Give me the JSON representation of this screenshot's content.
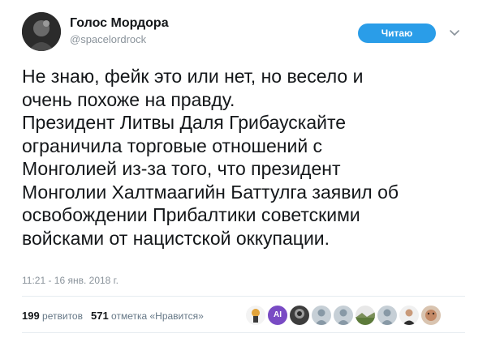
{
  "author": {
    "name": "Голос Мордора",
    "handle": "@spacelordrock"
  },
  "follow_button": "Читаю",
  "tweet_lines": [
    "Не знаю, фейк это или нет, но весело и",
    "очень похоже на правду.",
    "Президент Литвы Даля Грибаускайте",
    "ограничила торговые отношений с",
    "Монголией из-за того, что президент",
    "Монголии Халтмаагийн Баттулга заявил об",
    "освобождении Прибалтики советскими",
    "войсками от нацистской оккупации."
  ],
  "timestamp": "11:21 - 16 янв. 2018 г.",
  "stats": {
    "retweets_count": "199",
    "retweets_label": "ретвитов",
    "likes_count": "571",
    "likes_label": "отметка «Нравится»"
  },
  "liker_avatars": [
    {
      "icon": "character-avatar"
    },
    {
      "icon": "ai-avatar",
      "text": "AI"
    },
    {
      "icon": "photo-avatar"
    },
    {
      "icon": "default-egg-avatar"
    },
    {
      "icon": "default-egg-avatar"
    },
    {
      "icon": "landscape-avatar"
    },
    {
      "icon": "default-egg-avatar"
    },
    {
      "icon": "person-avatar"
    },
    {
      "icon": "face-avatar"
    }
  ],
  "colors": {
    "follow_button_bg": "#2a9de8",
    "secondary_text": "#8a939b",
    "ai_avatar_bg": "#794bc4"
  }
}
